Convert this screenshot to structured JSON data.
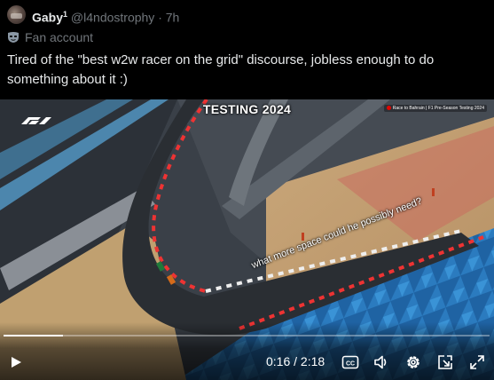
{
  "post": {
    "display_name": "Gaby",
    "verified_superscript": "1",
    "handle": "@l4ndostrophy",
    "separator": "·",
    "time": "7h",
    "affiliation": "Fan account",
    "affiliation_icon": "mask-icon",
    "text": "Tired of the \"best w2w racer on the grid\" discourse, jobless enough to do something about it :)"
  },
  "video": {
    "overlay_title": "TESTING 2024",
    "broadcast_tag": "Race to Bahrain | F1 Pre-Season Testing 2024",
    "overlay_caption": "what more space could he possibly need?",
    "logo_icon": "f1-logo-icon",
    "progress": 0.122,
    "current_time": "0:16",
    "duration_sep": " / ",
    "duration": "2:18",
    "controls": {
      "play": "play-icon",
      "captions": "CC",
      "captions_icon": "closed-captions-icon",
      "volume": "volume-icon",
      "settings": "gear-icon",
      "popout": "popout-icon",
      "fullscreen": "fullscreen-icon"
    }
  }
}
